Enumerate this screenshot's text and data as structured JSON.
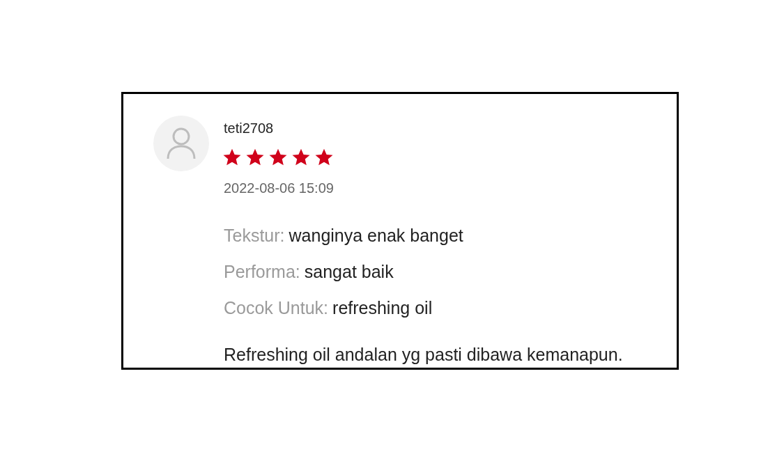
{
  "review": {
    "username": "teti2708",
    "stars": 5,
    "date": "2022-08-06 15:09",
    "attributes": [
      {
        "label": "Tekstur:",
        "value": "wanginya enak banget"
      },
      {
        "label": "Performa:",
        "value": "sangat baik"
      },
      {
        "label": "Cocok Untuk:",
        "value": "refreshing oil"
      }
    ],
    "text": "Refreshing oil andalan yg pasti dibawa kemanapun."
  }
}
